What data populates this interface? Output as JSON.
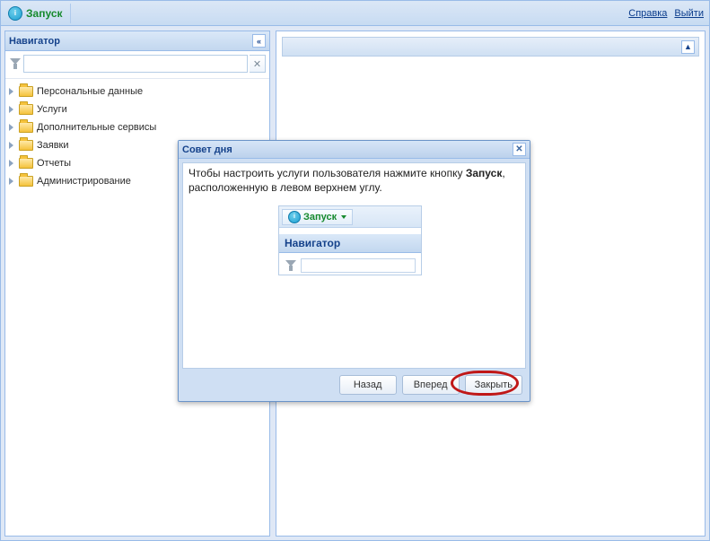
{
  "topbar": {
    "start": "Запуск",
    "help": "Справка",
    "logout": "Выйти"
  },
  "navigator": {
    "title": "Навигатор",
    "filter_placeholder": "",
    "items": [
      {
        "label": "Персональные данные"
      },
      {
        "label": "Услуги"
      },
      {
        "label": "Дополнительные сервисы"
      },
      {
        "label": "Заявки"
      },
      {
        "label": "Отчеты"
      },
      {
        "label": "Администрирование"
      }
    ]
  },
  "dialog": {
    "title": "Совет дня",
    "tip_text_1": "Чтобы настроить услуги пользователя нажмите кнопку ",
    "tip_bold": "Запуск",
    "tip_text_2": ", расположенную в левом верхнем углу.",
    "mini_start": "Запуск",
    "mini_nav": "Навигатор",
    "buttons": {
      "back": "Назад",
      "forward": "Вперед",
      "close": "Закрыть"
    }
  },
  "icons": {
    "collapse_left": "«",
    "collapse_up": "▲",
    "close_x": "✕",
    "clear_x": "✕"
  }
}
